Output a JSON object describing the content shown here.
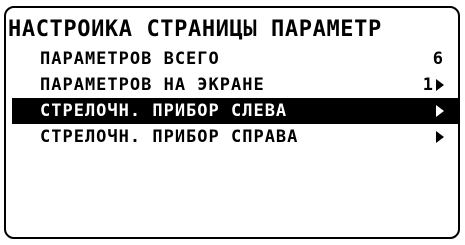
{
  "screen": {
    "title": "НАСТРОЙКА СТРАНИЦЫ ПАРАМЕТР"
  },
  "menu": {
    "items": [
      {
        "label": "ПАРАМЕТРОВ ВСЕГО",
        "value": "6",
        "has_arrow": false,
        "selected": false
      },
      {
        "label": "ПАРАМЕТРОВ НА ЭКРАНЕ",
        "value": "1",
        "has_arrow": true,
        "selected": false
      },
      {
        "label": "СТРЕЛОЧН. ПРИБОР СЛЕВА",
        "value": "",
        "has_arrow": true,
        "selected": true
      },
      {
        "label": "СТРЕЛОЧН. ПРИБОР СПРАВА",
        "value": "",
        "has_arrow": true,
        "selected": false
      }
    ]
  },
  "icons": {
    "submenu_arrow": "triangle-right-icon"
  },
  "colors": {
    "background": "#ffffff",
    "foreground": "#000000",
    "highlight_bg": "#000000",
    "highlight_fg": "#ffffff"
  }
}
